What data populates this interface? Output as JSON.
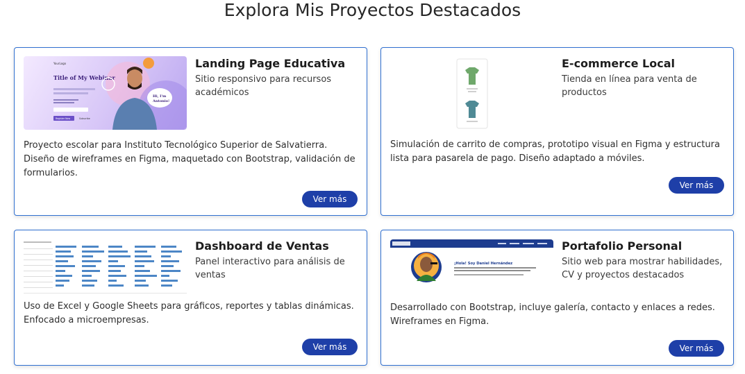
{
  "section": {
    "title": "Explora Mis Proyectos Destacados"
  },
  "projects": [
    {
      "title": "Landing Page Educativa",
      "subtitle": "Sitio responsivo para recursos académicos",
      "description": "Proyecto escolar para Instituto Tecnológico Superior de Salvatierra. Diseño de wireframes en Figma, maquetado con Bootstrap, validación de formularios.",
      "button": "Ver más",
      "thumb": {
        "brand": "YourLogo",
        "heading": "Title of My Webinar",
        "badge": "Hi, I'm Antonio!",
        "cta1": "Register Now",
        "cta2": "Subscribe"
      }
    },
    {
      "title": "E-commerce Local",
      "subtitle": "Tienda en línea para venta de productos",
      "description": "Simulación de carrito de compras, prototipo visual en Figma y estructura lista para pasarela de pago. Diseño adaptado a móviles.",
      "button": "Ver más"
    },
    {
      "title": "Dashboard de Ventas",
      "subtitle": "Panel interactivo para análisis de ventas",
      "description": "Uso de Excel y Google Sheets para gráficos, reportes y tablas dinámicas. Enfocado a microempresas.",
      "button": "Ver más"
    },
    {
      "title": "Portafolio Personal",
      "subtitle": "Sitio web para mostrar habilidades, CV y proyectos destacados",
      "description": "Desarrollado con Bootstrap, incluye galería, contacto y enlaces a redes. Wireframes en Figma.",
      "button": "Ver más",
      "thumb": {
        "heading": "¡Hola! Soy Daniel Hernández"
      }
    }
  ],
  "colors": {
    "accent": "#1e3fa8",
    "border": "#2f6fd0"
  }
}
